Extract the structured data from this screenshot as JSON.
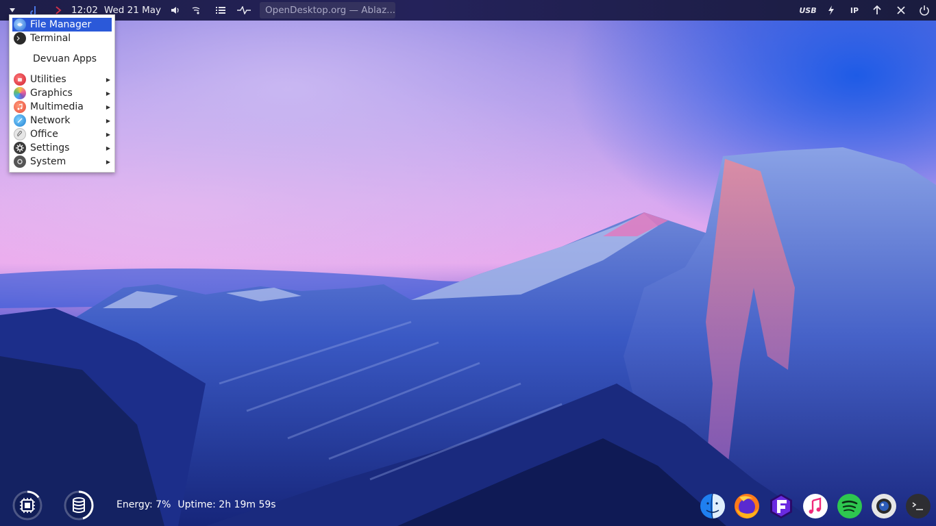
{
  "top_panel": {
    "clock": "12:02",
    "date": "Wed 21 May",
    "window_title": "OpenDesktop.org — Ablaz...",
    "usb_label": "USB",
    "ip_label": "IP",
    "icons": [
      "menu-arrow-icon",
      "app-icon",
      "arrow-icon",
      "volume-icon",
      "network-icon",
      "task-list-icon",
      "pulse-icon",
      "flash-icon",
      "up-arrow-icon",
      "close-icon",
      "power-icon"
    ]
  },
  "menu": {
    "file_manager": "File Manager",
    "terminal": "Terminal",
    "devuan_apps": "Devuan Apps",
    "utilities": "Utilities",
    "graphics": "Graphics",
    "multimedia": "Multimedia",
    "network": "Network",
    "office": "Office",
    "settings": "Settings",
    "system": "System",
    "submenu_arrow": "▶"
  },
  "status": {
    "energy": "Energy: 7%",
    "uptime": "Uptime: 2h 19m 59s",
    "cpu_ring_level": 0.15,
    "disk_ring_level": 0.45
  },
  "dock": {
    "icons": [
      "finder-icon",
      "firefox-icon",
      "f-app-icon",
      "music-icon",
      "spotify-icon",
      "camera-icon",
      "terminal-icon"
    ]
  },
  "colors": {
    "menu_highlight": "#2b59d9",
    "panel": "#1e1e48"
  }
}
